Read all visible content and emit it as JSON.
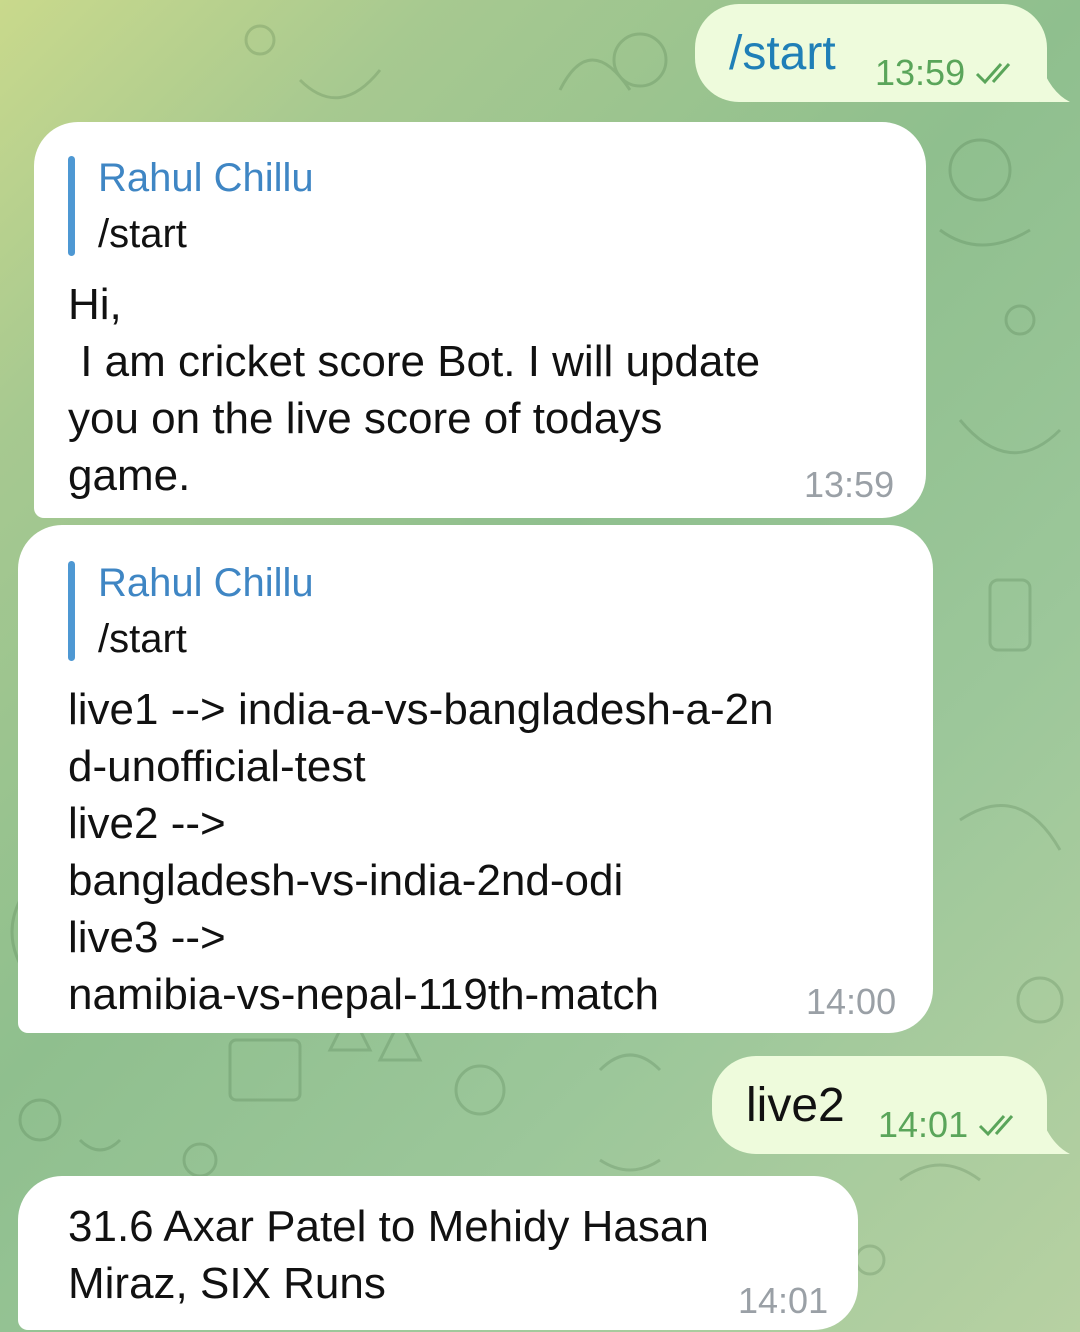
{
  "messages": [
    {
      "text": "/start",
      "time": "13:59"
    },
    {
      "reply_name": "Rahul Chillu",
      "reply_text": "/start",
      "text": "Hi,\n I am cricket score Bot. I will update\nyou on the live score of todays\ngame.",
      "time": "13:59"
    },
    {
      "reply_name": "Rahul Chillu",
      "reply_text": "/start",
      "text": "live1 --> india-a-vs-bangladesh-a-2n\nd-unofficial-test\nlive2 -->\nbangladesh-vs-india-2nd-odi\nlive3 -->\nnamibia-vs-nepal-119th-match",
      "time": "14:00"
    },
    {
      "text": "live2",
      "time": "14:01"
    },
    {
      "text": "31.6 Axar Patel to Mehidy Hasan\nMiraz, SIX Runs",
      "time": "14:01"
    }
  ],
  "icons": {
    "read_receipt": "double-check-icon"
  },
  "colors": {
    "incoming": "#ffffff",
    "outgoing": "#eefbdc",
    "link_blue": "#1f7fb7",
    "reply_bar": "#4e98d3",
    "reply_name": "#3f86c4",
    "out_time": "#5aa55a"
  }
}
